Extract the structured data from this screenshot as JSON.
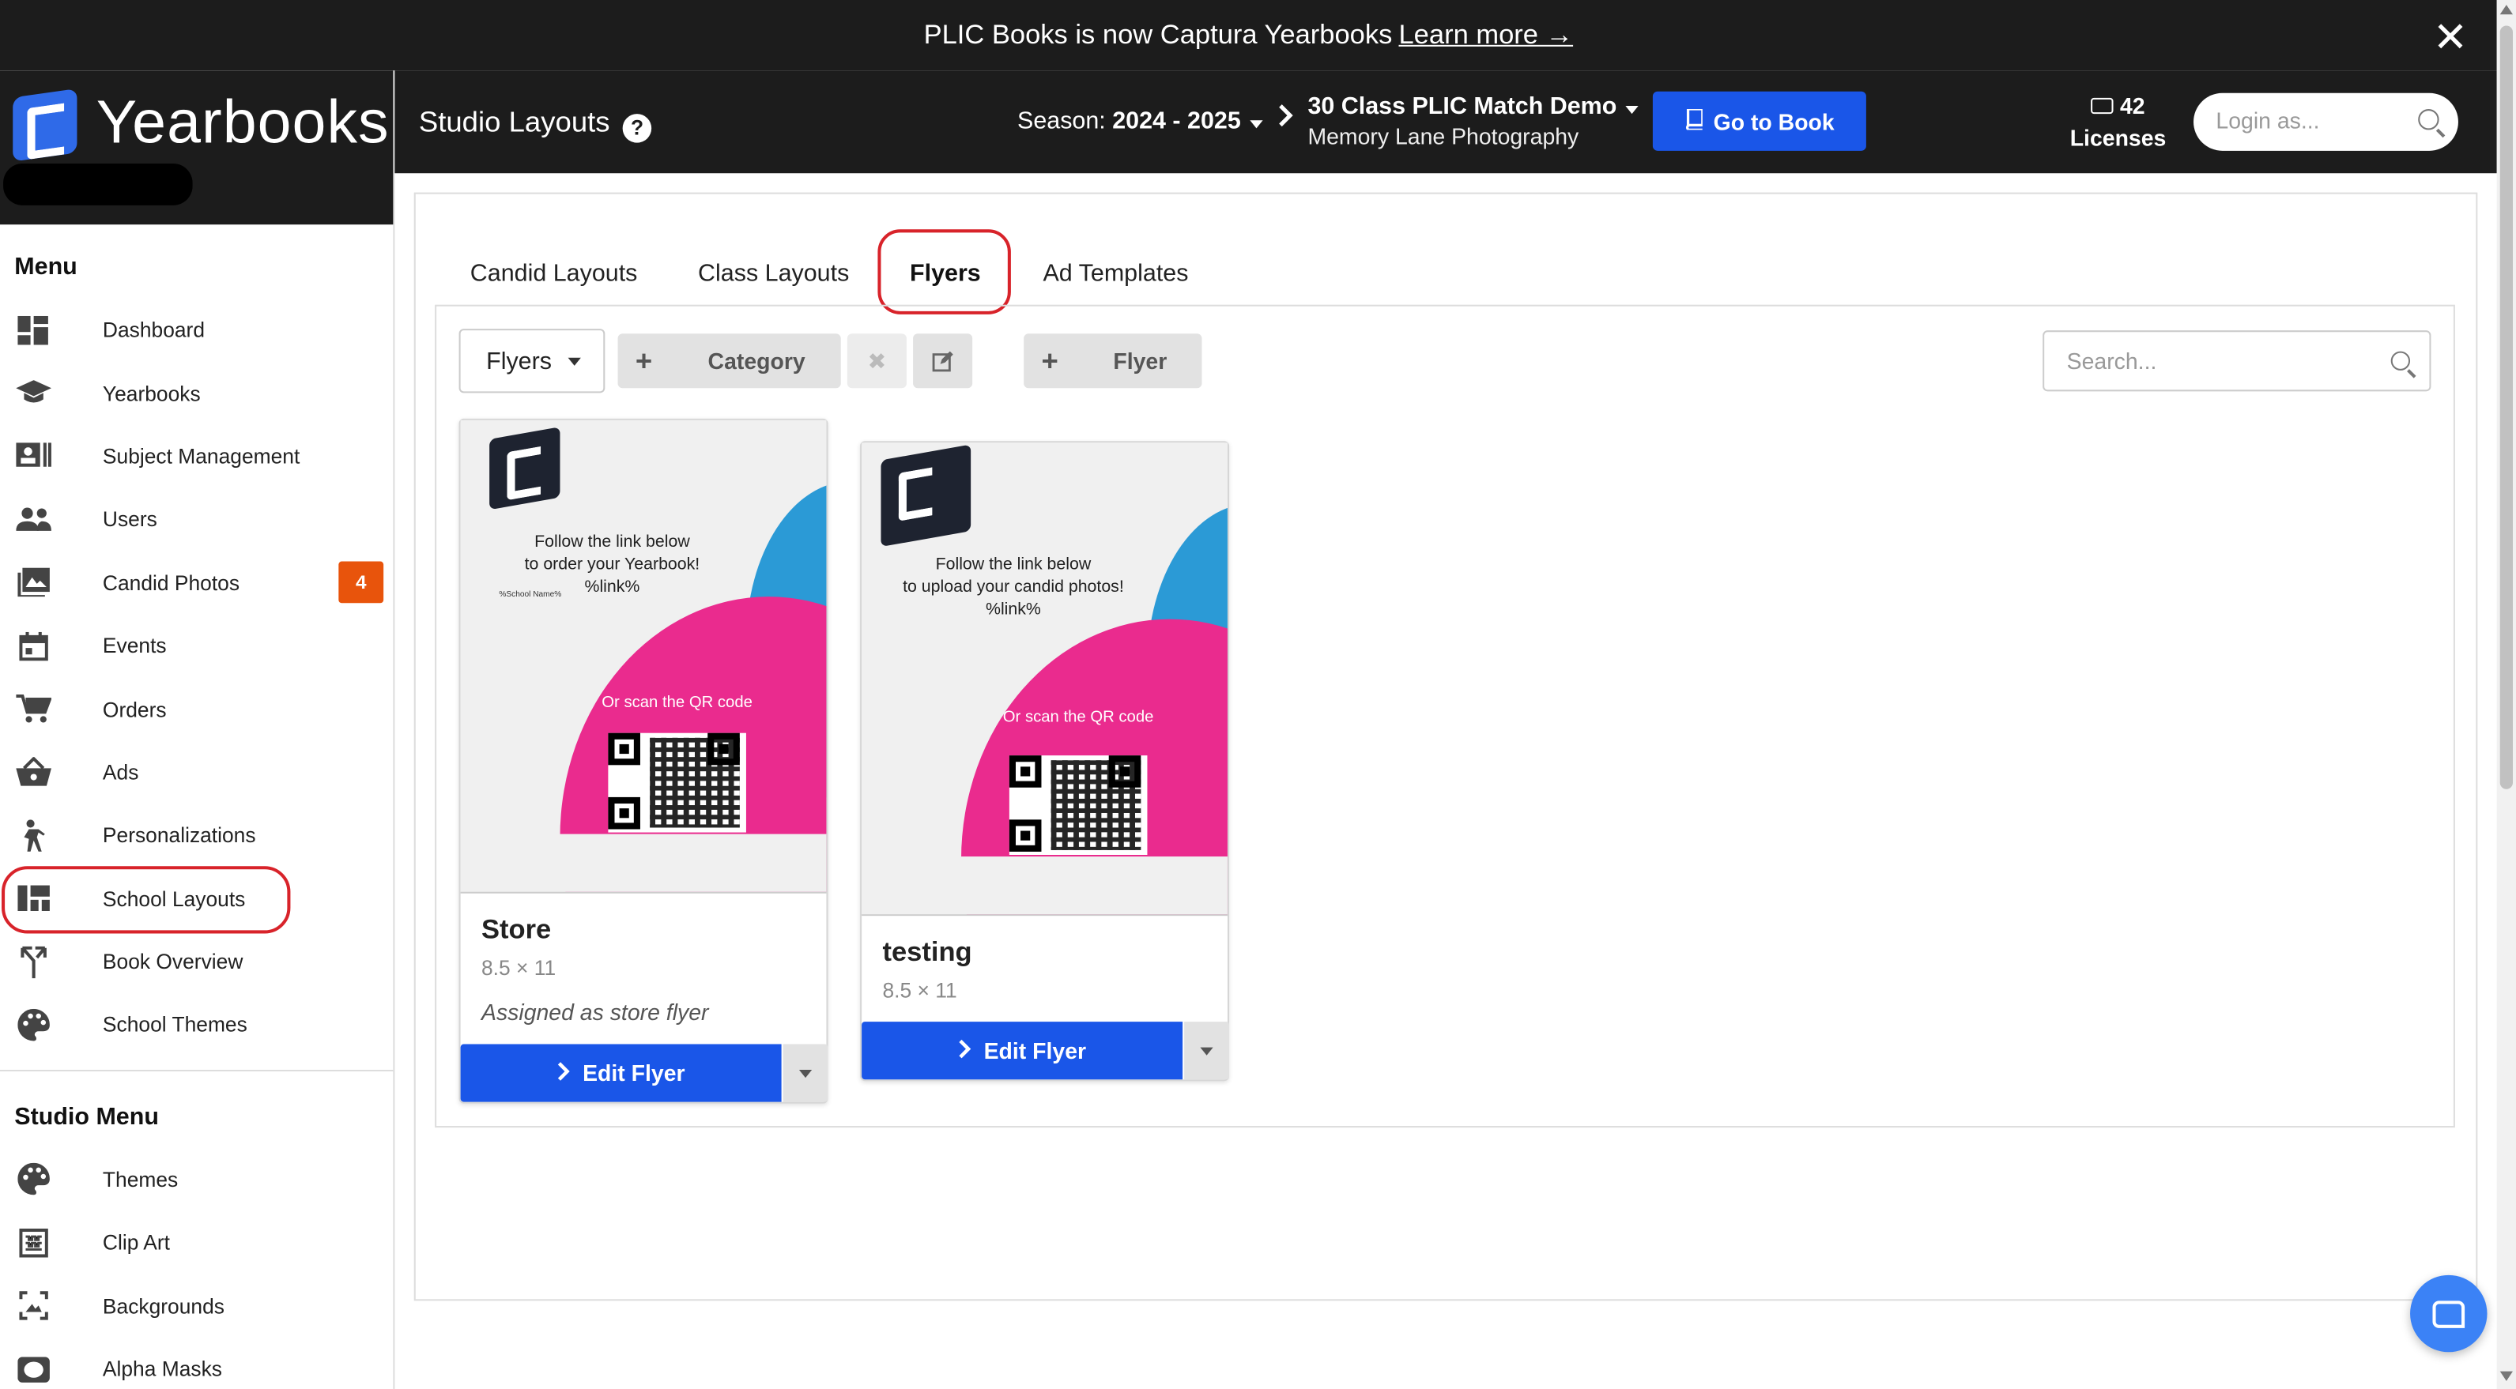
{
  "banner": {
    "text": "PLIC Books is now Captura Yearbooks",
    "link": "Learn more →",
    "close": "✕"
  },
  "brand": {
    "name": "Yearbooks"
  },
  "sidebar": {
    "menu_heading": "Menu",
    "items": [
      {
        "label": "Dashboard",
        "icon": "dashboard-icon"
      },
      {
        "label": "Yearbooks",
        "icon": "graduation-cap-icon"
      },
      {
        "label": "Subject Management",
        "icon": "id-card-icon"
      },
      {
        "label": "Users",
        "icon": "users-icon"
      },
      {
        "label": "Candid Photos",
        "icon": "photo-icon",
        "badge": "4"
      },
      {
        "label": "Events",
        "icon": "calendar-icon"
      },
      {
        "label": "Orders",
        "icon": "cart-icon"
      },
      {
        "label": "Ads",
        "icon": "basket-icon"
      },
      {
        "label": "Personalizations",
        "icon": "person-icon"
      },
      {
        "label": "School Layouts",
        "icon": "layout-icon"
      },
      {
        "label": "Book Overview",
        "icon": "fork-icon"
      },
      {
        "label": "School Themes",
        "icon": "palette-icon"
      }
    ],
    "studio_heading": "Studio Menu",
    "studio_items": [
      {
        "label": "Themes",
        "icon": "palette-icon"
      },
      {
        "label": "Clip Art",
        "icon": "clipart-icon"
      },
      {
        "label": "Backgrounds",
        "icon": "background-icon"
      },
      {
        "label": "Alpha Masks",
        "icon": "mask-icon"
      }
    ]
  },
  "header": {
    "title": "Studio Layouts",
    "help": "?",
    "season_label": "Season:",
    "season_value": "2024 - 2025",
    "project_name": "30 Class PLIC Match Demo",
    "project_studio": "Memory Lane Photography",
    "go_to_book": "Go to Book",
    "licenses_count": "42",
    "licenses_label": "Licenses",
    "login_placeholder": "Login as..."
  },
  "tabs": [
    {
      "label": "Candid Layouts",
      "active": false
    },
    {
      "label": "Class Layouts",
      "active": false
    },
    {
      "label": "Flyers",
      "active": true
    },
    {
      "label": "Ad Templates",
      "active": false
    }
  ],
  "toolbar": {
    "dropdown": "Flyers",
    "category_button": "Category",
    "flyer_button": "Flyer",
    "search_placeholder": "Search..."
  },
  "flyers": [
    {
      "title": "Store",
      "size": "8.5 × 11",
      "note": "Assigned as store flyer",
      "edit": "Edit Flyer",
      "thumb_lines": [
        "Follow the link below",
        "to order your Yearbook!",
        "%link%"
      ],
      "thumb_small": "%School Name%",
      "thumb_scan": "Or scan the QR code"
    },
    {
      "title": "testing",
      "size": "8.5 × 11",
      "edit": "Edit Flyer",
      "thumb_lines": [
        "Follow the link below",
        "to upload your candid photos!",
        "%link%"
      ],
      "thumb_scan": "Or scan the QR code"
    }
  ],
  "colors": {
    "primary": "#1a56e8",
    "dark": "#1c1c1c",
    "badge": "#e8540c",
    "highlight": "#d8232a",
    "flyer_pink": "#ea2b8e",
    "flyer_blue": "#2b9ad6"
  }
}
